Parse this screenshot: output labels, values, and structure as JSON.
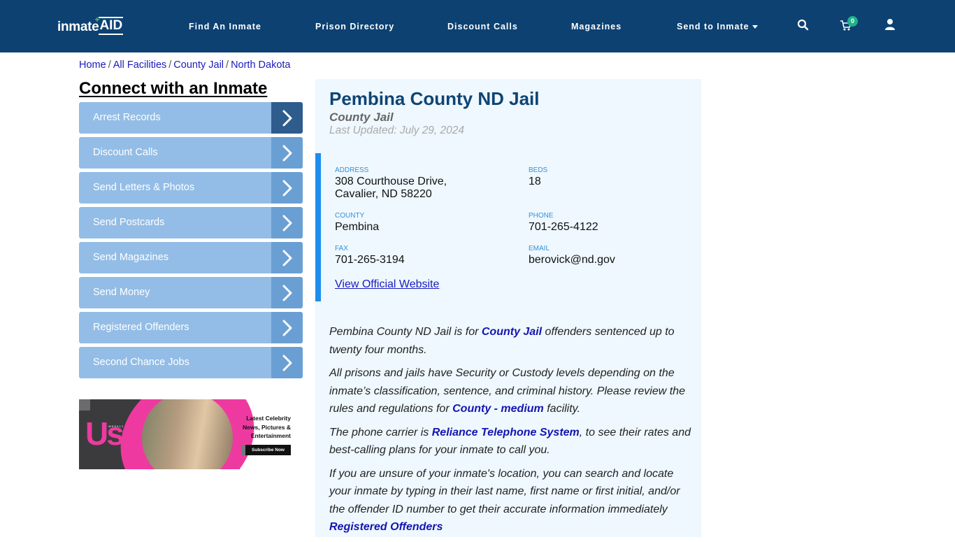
{
  "header": {
    "logo": {
      "text_main": "inmate",
      "text_accent": "AID",
      "plus": "+"
    },
    "nav": [
      {
        "label": "Find An Inmate"
      },
      {
        "label": "Prison Directory"
      },
      {
        "label": "Discount Calls"
      },
      {
        "label": "Magazines"
      },
      {
        "label": "Send to Inmate",
        "has_dropdown": true
      }
    ],
    "icons": {
      "search": "search-icon",
      "cart": "cart-icon",
      "user": "user-icon"
    },
    "cart_count": "0",
    "colors": {
      "bar": "#0c4172",
      "badge": "#1fb28b"
    }
  },
  "breadcrumb": [
    {
      "label": "Home"
    },
    {
      "label": "All Facilities"
    },
    {
      "label": "County Jail"
    },
    {
      "label": "North Dakota"
    }
  ],
  "breadcrumb_separator": "/",
  "sidebar": {
    "title": "Connect with an Inmate",
    "items": [
      {
        "label": "Arrest Records",
        "active": true
      },
      {
        "label": "Discount Calls"
      },
      {
        "label": "Send Letters & Photos"
      },
      {
        "label": "Send Postcards"
      },
      {
        "label": "Send Magazines"
      },
      {
        "label": "Send Money"
      },
      {
        "label": "Registered Offenders"
      },
      {
        "label": "Second Chance Jobs"
      }
    ],
    "ad": {
      "brand": "Us",
      "brand_small": "WEEKLY",
      "lines": [
        "Latest Celebrity",
        "News, Pictures &",
        "Entertainment"
      ],
      "cta": "Subscribe Now"
    }
  },
  "facility": {
    "name": "Pembina County ND Jail",
    "type": "County Jail",
    "last_updated": "Last Updated: July 29, 2024",
    "fields": {
      "address": {
        "label": "ADDRESS",
        "line1": "308 Courthouse Drive,",
        "line2": "Cavalier, ND 58220"
      },
      "beds": {
        "label": "BEDS",
        "value": "18"
      },
      "county": {
        "label": "COUNTY",
        "value": "Pembina"
      },
      "phone": {
        "label": "PHONE",
        "value": "701-265-4122"
      },
      "fax": {
        "label": "FAX",
        "value": "701-265-3194"
      },
      "email": {
        "label": "EMAIL",
        "value": "berovick@nd.gov"
      }
    },
    "website_link": "View Official Website",
    "description": {
      "p1": {
        "before": "Pembina County ND Jail is for ",
        "link": "County Jail",
        "after": " offenders sentenced up to twenty four months."
      },
      "p2": {
        "before": "All prisons and jails have Security or Custody levels depending on the inmate’s classification, sentence, and criminal history. Please review the rules and regulations for ",
        "link": "County - medium",
        "after": " facility."
      },
      "p3": {
        "before": "The phone carrier is ",
        "link": "Reliance Telephone System",
        "after": ", to see their rates and best-calling plans for your inmate to call you."
      },
      "p4": {
        "before": "If you are unsure of your inmate's location, you can search and locate your inmate by typing in their last name, first name or first initial, and/or the offender ID number to get their accurate information immediately ",
        "link": "Registered Offenders",
        "after": ""
      }
    },
    "colors": {
      "panel_bg": "#eef8fe",
      "accent_bar": "#1d8ef0",
      "title": "#0f4474",
      "link": "#1515b0"
    }
  }
}
